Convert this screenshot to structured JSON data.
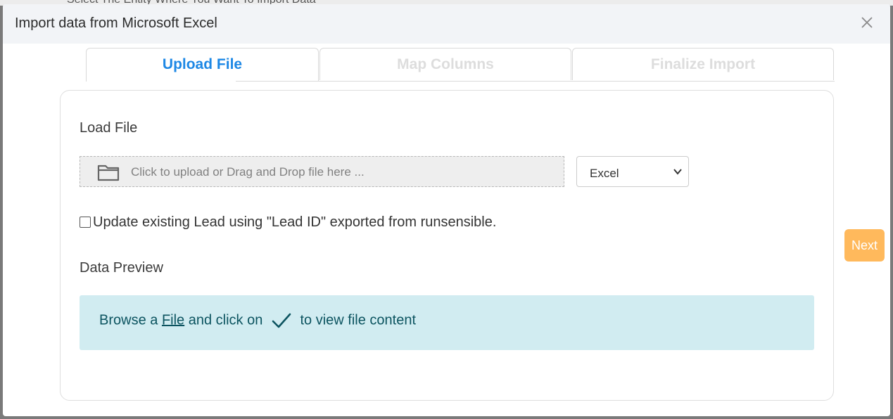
{
  "background": {
    "obscured_title": "Select The Entity Where You Want To Import Data"
  },
  "modal": {
    "title": "Import data from Microsoft Excel",
    "close_icon": "close-icon"
  },
  "tabs": [
    {
      "label": "Upload File",
      "active": true
    },
    {
      "label": "Map Columns",
      "active": false
    },
    {
      "label": "Finalize Import",
      "active": false
    }
  ],
  "load_file": {
    "heading": "Load File",
    "upload_placeholder": "Click to upload or Drag and Drop file here ...",
    "upload_icon": "folder-icon",
    "format_selected": "Excel"
  },
  "update_option": {
    "checked": false,
    "label": "Update existing Lead using \"Lead ID\" exported from runsensible."
  },
  "data_preview": {
    "heading": "Data Preview",
    "message_prefix": "Browse a",
    "message_link": "File",
    "message_middle": "and click on",
    "message_icon": "checkmark-icon",
    "message_suffix": "to view file content"
  },
  "actions": {
    "next_label": "Next"
  },
  "colors": {
    "active_tab": "#1e88e5",
    "inactive_tab": "#dddddd",
    "next_button": "#ffb95c",
    "alert_bg": "#d1ecf1",
    "alert_text": "#0c5460"
  }
}
